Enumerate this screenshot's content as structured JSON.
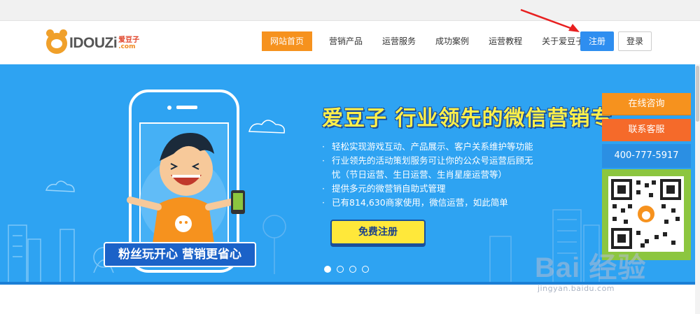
{
  "logo": {
    "wordmark": "IDOUZi",
    "cn": "爱豆子",
    "domain": ".com"
  },
  "nav": {
    "items": [
      {
        "label": "网站首页",
        "active": true
      },
      {
        "label": "营销产品"
      },
      {
        "label": "运营服务"
      },
      {
        "label": "成功案例"
      },
      {
        "label": "运营教程"
      },
      {
        "label": "关于爱豆子"
      }
    ],
    "register": "注册",
    "login": "登录"
  },
  "banner": {
    "headline": "爱豆子 行业领先的微信营销专",
    "features": [
      "轻松实现游戏互动、产品展示、客户关系维护等功能",
      "行业领先的活动策划服务可让你的公众号运营后顾无",
      "忧（节日运营、生日运营、生肖星座运营等）",
      "提供多元的微营销自助式管理",
      "已有814,630商家使用，微信运营，如此简单"
    ],
    "cta": "免费注册",
    "slogan": "粉丝玩开心 营销更省心",
    "slide_count": 4,
    "active_slide": 1
  },
  "sidebar": {
    "online": "在线咨询",
    "service": "联系客服",
    "phone": "400-777-5917"
  },
  "watermark": {
    "brand": "Bai 经验",
    "url": "jingyan.baidu.com"
  },
  "colors": {
    "banner_bg": "#2ea3f2",
    "active_nav": "#f6921e",
    "register_btn": "#2e8ef0",
    "cta_bg": "#ffe83a",
    "headline": "#fff04a"
  }
}
